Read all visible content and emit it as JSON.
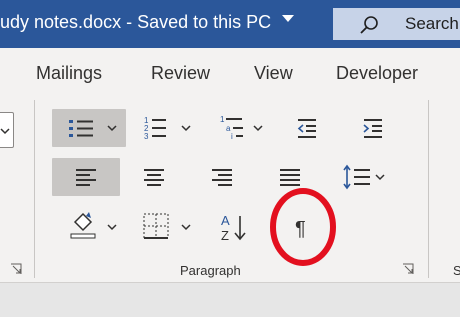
{
  "titlebar": {
    "doc_title": "udy notes.docx  -  Saved to this PC",
    "search_label": "Search"
  },
  "tabs": [
    "Mailings",
    "Review",
    "View",
    "Developer"
  ],
  "paragraph_group": {
    "label": "Paragraph",
    "next_group_partial": "S"
  },
  "annotation": {
    "circle_color": "#e3101f"
  },
  "colors": {
    "titlebar": "#2b579a",
    "ribbon": "#f3f2f1",
    "icon_blue": "#2b579a",
    "active_button": "#c8c6c4"
  }
}
